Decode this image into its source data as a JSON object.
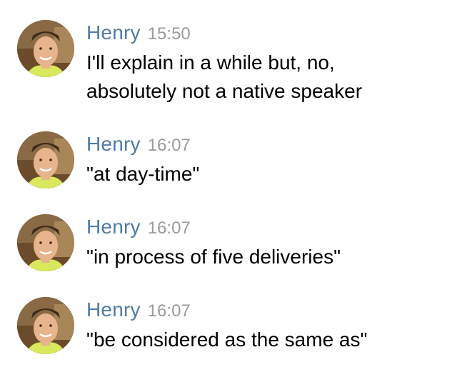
{
  "colors": {
    "sender_name": "#4e7ba8",
    "timestamp": "#9a9a9a",
    "message_text": "#000000",
    "background": "#ffffff"
  },
  "messages": [
    {
      "sender": "Henry",
      "time": "15:50",
      "lines": [
        "I'll explain in a while but, no,",
        "absolutely not a native speaker"
      ],
      "avatar_icon": "user-photo"
    },
    {
      "sender": "Henry",
      "time": "16:07",
      "lines": [
        "\"at day-time\""
      ],
      "avatar_icon": "user-photo"
    },
    {
      "sender": "Henry",
      "time": "16:07",
      "lines": [
        "\"in process of five deliveries\""
      ],
      "avatar_icon": "user-photo"
    },
    {
      "sender": "Henry",
      "time": "16:07",
      "lines": [
        "\"be considered as the same as\""
      ],
      "avatar_icon": "user-photo"
    }
  ]
}
